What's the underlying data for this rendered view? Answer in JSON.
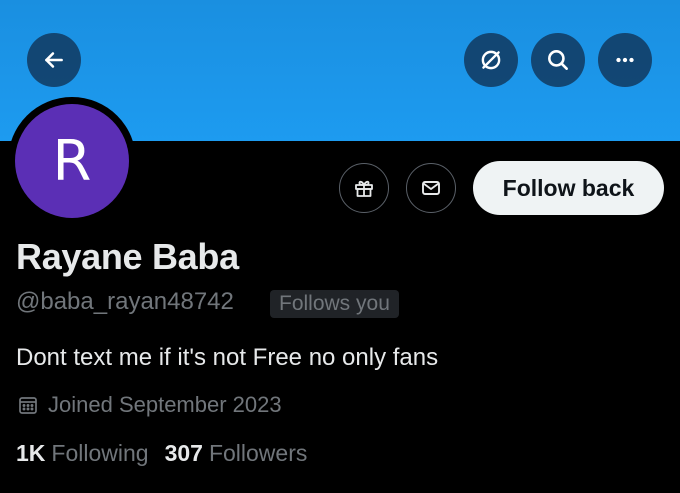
{
  "header": {
    "icons": [
      "back-arrow-icon",
      "translate-off-icon",
      "search-icon",
      "more-icon"
    ]
  },
  "profile": {
    "avatar_letter": "R",
    "avatar_color": "#5b2fb5",
    "name": "Rayane Baba",
    "handle": "@baba_rayan48742",
    "follows_you": "Follows you",
    "bio": "Dont text me if it's not Free no only fans",
    "joined": "Joined September 2023",
    "following_count": "1K",
    "following_label": "Following",
    "followers_count": "307",
    "followers_label": "Followers"
  },
  "actions": {
    "follow_back_label": "Follow back",
    "icons": [
      "gift-icon",
      "mail-icon"
    ]
  },
  "colors": {
    "banner": "#1d9bf0",
    "background": "#000000",
    "text_primary": "#e7e9ea",
    "text_secondary": "#71767b"
  }
}
